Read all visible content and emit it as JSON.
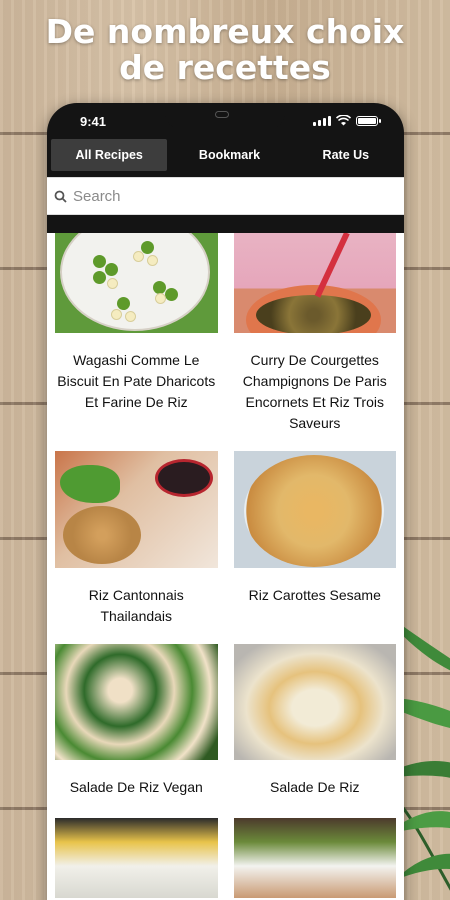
{
  "hero": {
    "line1": "De nombreux choix",
    "line2": "de recettes"
  },
  "status_bar": {
    "time": "9:41"
  },
  "tabs": [
    {
      "label": "All Recipes",
      "active": true
    },
    {
      "label": "Bookmark",
      "active": false
    },
    {
      "label": "Rate Us",
      "active": false
    }
  ],
  "search": {
    "placeholder": "Search"
  },
  "recipes": [
    {
      "title": "Wagashi Comme Le Biscuit En Pate Dharicots Et Farine De Riz"
    },
    {
      "title": "Curry De Courgettes Champignons De Paris Encornets Et Riz Trois Saveurs"
    },
    {
      "title": "Riz Cantonnais Thailandais"
    },
    {
      "title": "Riz Carottes Sesame"
    },
    {
      "title": "Salade De Riz Vegan"
    },
    {
      "title": "Salade De Riz"
    }
  ],
  "colors": {
    "header_bg": "#141414",
    "active_tab_bg": "#3d3d3d"
  }
}
